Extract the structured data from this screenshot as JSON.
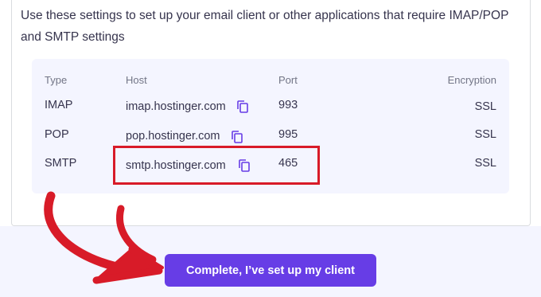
{
  "intro_text": "Use these settings to set up your email client or other applications that require IMAP/POP and SMTP settings",
  "table": {
    "headers": {
      "type": "Type",
      "host": "Host",
      "port": "Port",
      "encryption": "Encryption"
    },
    "rows": [
      {
        "type": "IMAP",
        "host": "imap.hostinger.com",
        "port": "993",
        "encryption": "SSL"
      },
      {
        "type": "POP",
        "host": "pop.hostinger.com",
        "port": "995",
        "encryption": "SSL"
      },
      {
        "type": "SMTP",
        "host": "smtp.hostinger.com",
        "port": "465",
        "encryption": "SSL"
      }
    ]
  },
  "copy_icon": "copy-icon",
  "complete_button_label": "Complete, I’ve set up my client",
  "colors": {
    "accent": "#673de6",
    "annotation_red": "#d81b28",
    "panel_bg": "#f4f5ff"
  }
}
